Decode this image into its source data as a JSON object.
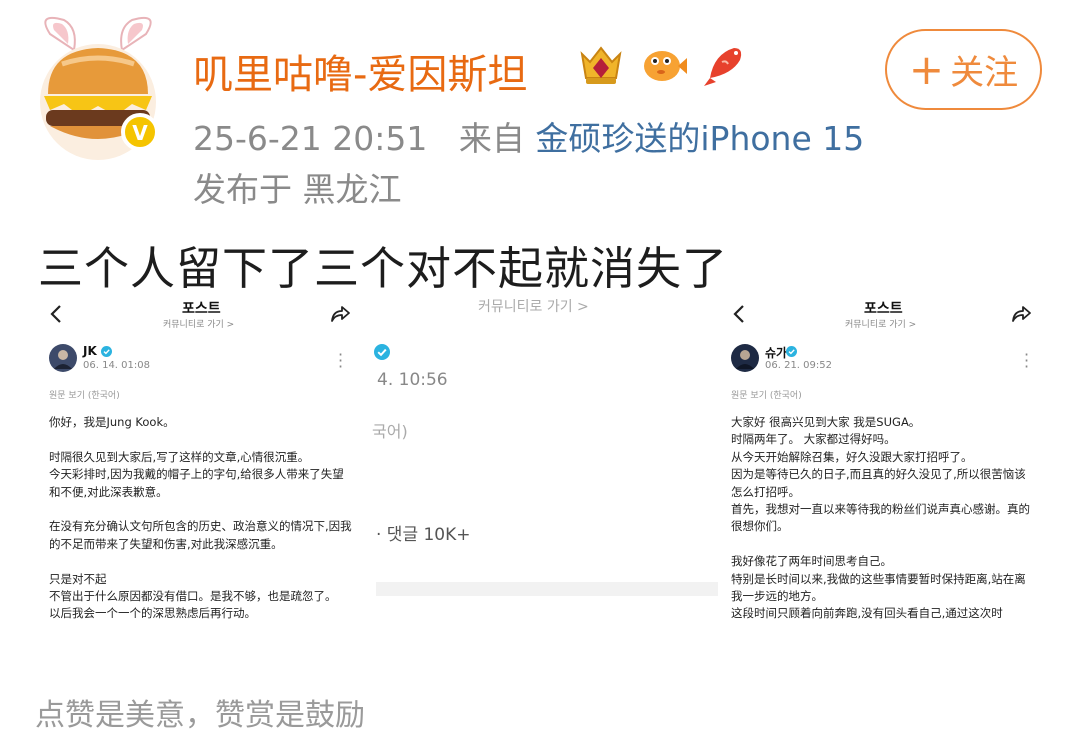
{
  "header": {
    "username": "叽里咕噜-爱因斯坦",
    "badges": [
      "crown-badge-icon",
      "pufferfish-badge-icon",
      "koi-fish-badge-icon"
    ],
    "follow_plus": "+",
    "follow_label": "关注",
    "timestamp": "25-6-21 20:51",
    "from_label": "来自",
    "source": "金硕珍送的iPhone 15",
    "location": "发布于 黑龙江"
  },
  "post": {
    "text": "三个人留下了三个对不起就消失了"
  },
  "screenshots": [
    {
      "nav_title": "포스트",
      "nav_sub": "커뮤니티로 가기 >",
      "handle": "JK",
      "time": "06. 14. 01:08",
      "orig_label": "원문 보기  (한국어)",
      "lines": [
        "你好，我是Jung Kook。",
        "",
        "时隔很久见到大家后,写了这样的文章,心情很沉重。",
        "今天彩排时,因为我戴的帽子上的字句,给很多人带来了失望",
        "和不便,对此深表歉意。",
        "",
        "在没有充分确认文句所包含的历史、政治意义的情况下,因我",
        "的不足而带来了失望和伤害,对此我深感沉重。",
        "",
        "只是对不起",
        "不管出于什么原因都没有借口。是我不够，也是疏忽了。",
        "以后我会一个一个的深思熟虑后再行动。"
      ]
    },
    {
      "nav_sub": "커뮤니티로 가기 >",
      "time": "4. 10:56",
      "orig_fragment": "국어)",
      "comments": "· 댓글 10K+"
    },
    {
      "nav_title": "포스트",
      "nav_sub": "커뮤니티로 가기 >",
      "handle": "슈가",
      "time": "06. 21. 09:52",
      "orig_label": "원문 보기  (한국어)",
      "lines": [
        "大家好 很高兴见到大家 我是SUGA。",
        "时隔两年了。 大家都过得好吗。",
        "从今天开始解除召集，好久没跟大家打招呼了。",
        "因为是等待已久的日子,而且真的好久没见了,所以很苦恼该",
        "怎么打招呼。",
        "首先，我想对一直以来等待我的粉丝们说声真心感谢。真的",
        "很想你们。",
        "",
        "我好像花了两年时间思考自己。",
        "特别是长时间以来,我做的这些事情要暂时保持距离,站在离",
        "我一步远的地方。",
        "这段时间只顾着向前奔跑,没有回头看自己,通过这次时"
      ]
    }
  ],
  "footer": {
    "partial_text": "点赞是美意，赞赏是鼓励"
  },
  "colors": {
    "username": "#e86a12",
    "follow": "#ef8a3c",
    "source": "#3f6fa0",
    "verified": "#2bb3e0"
  }
}
